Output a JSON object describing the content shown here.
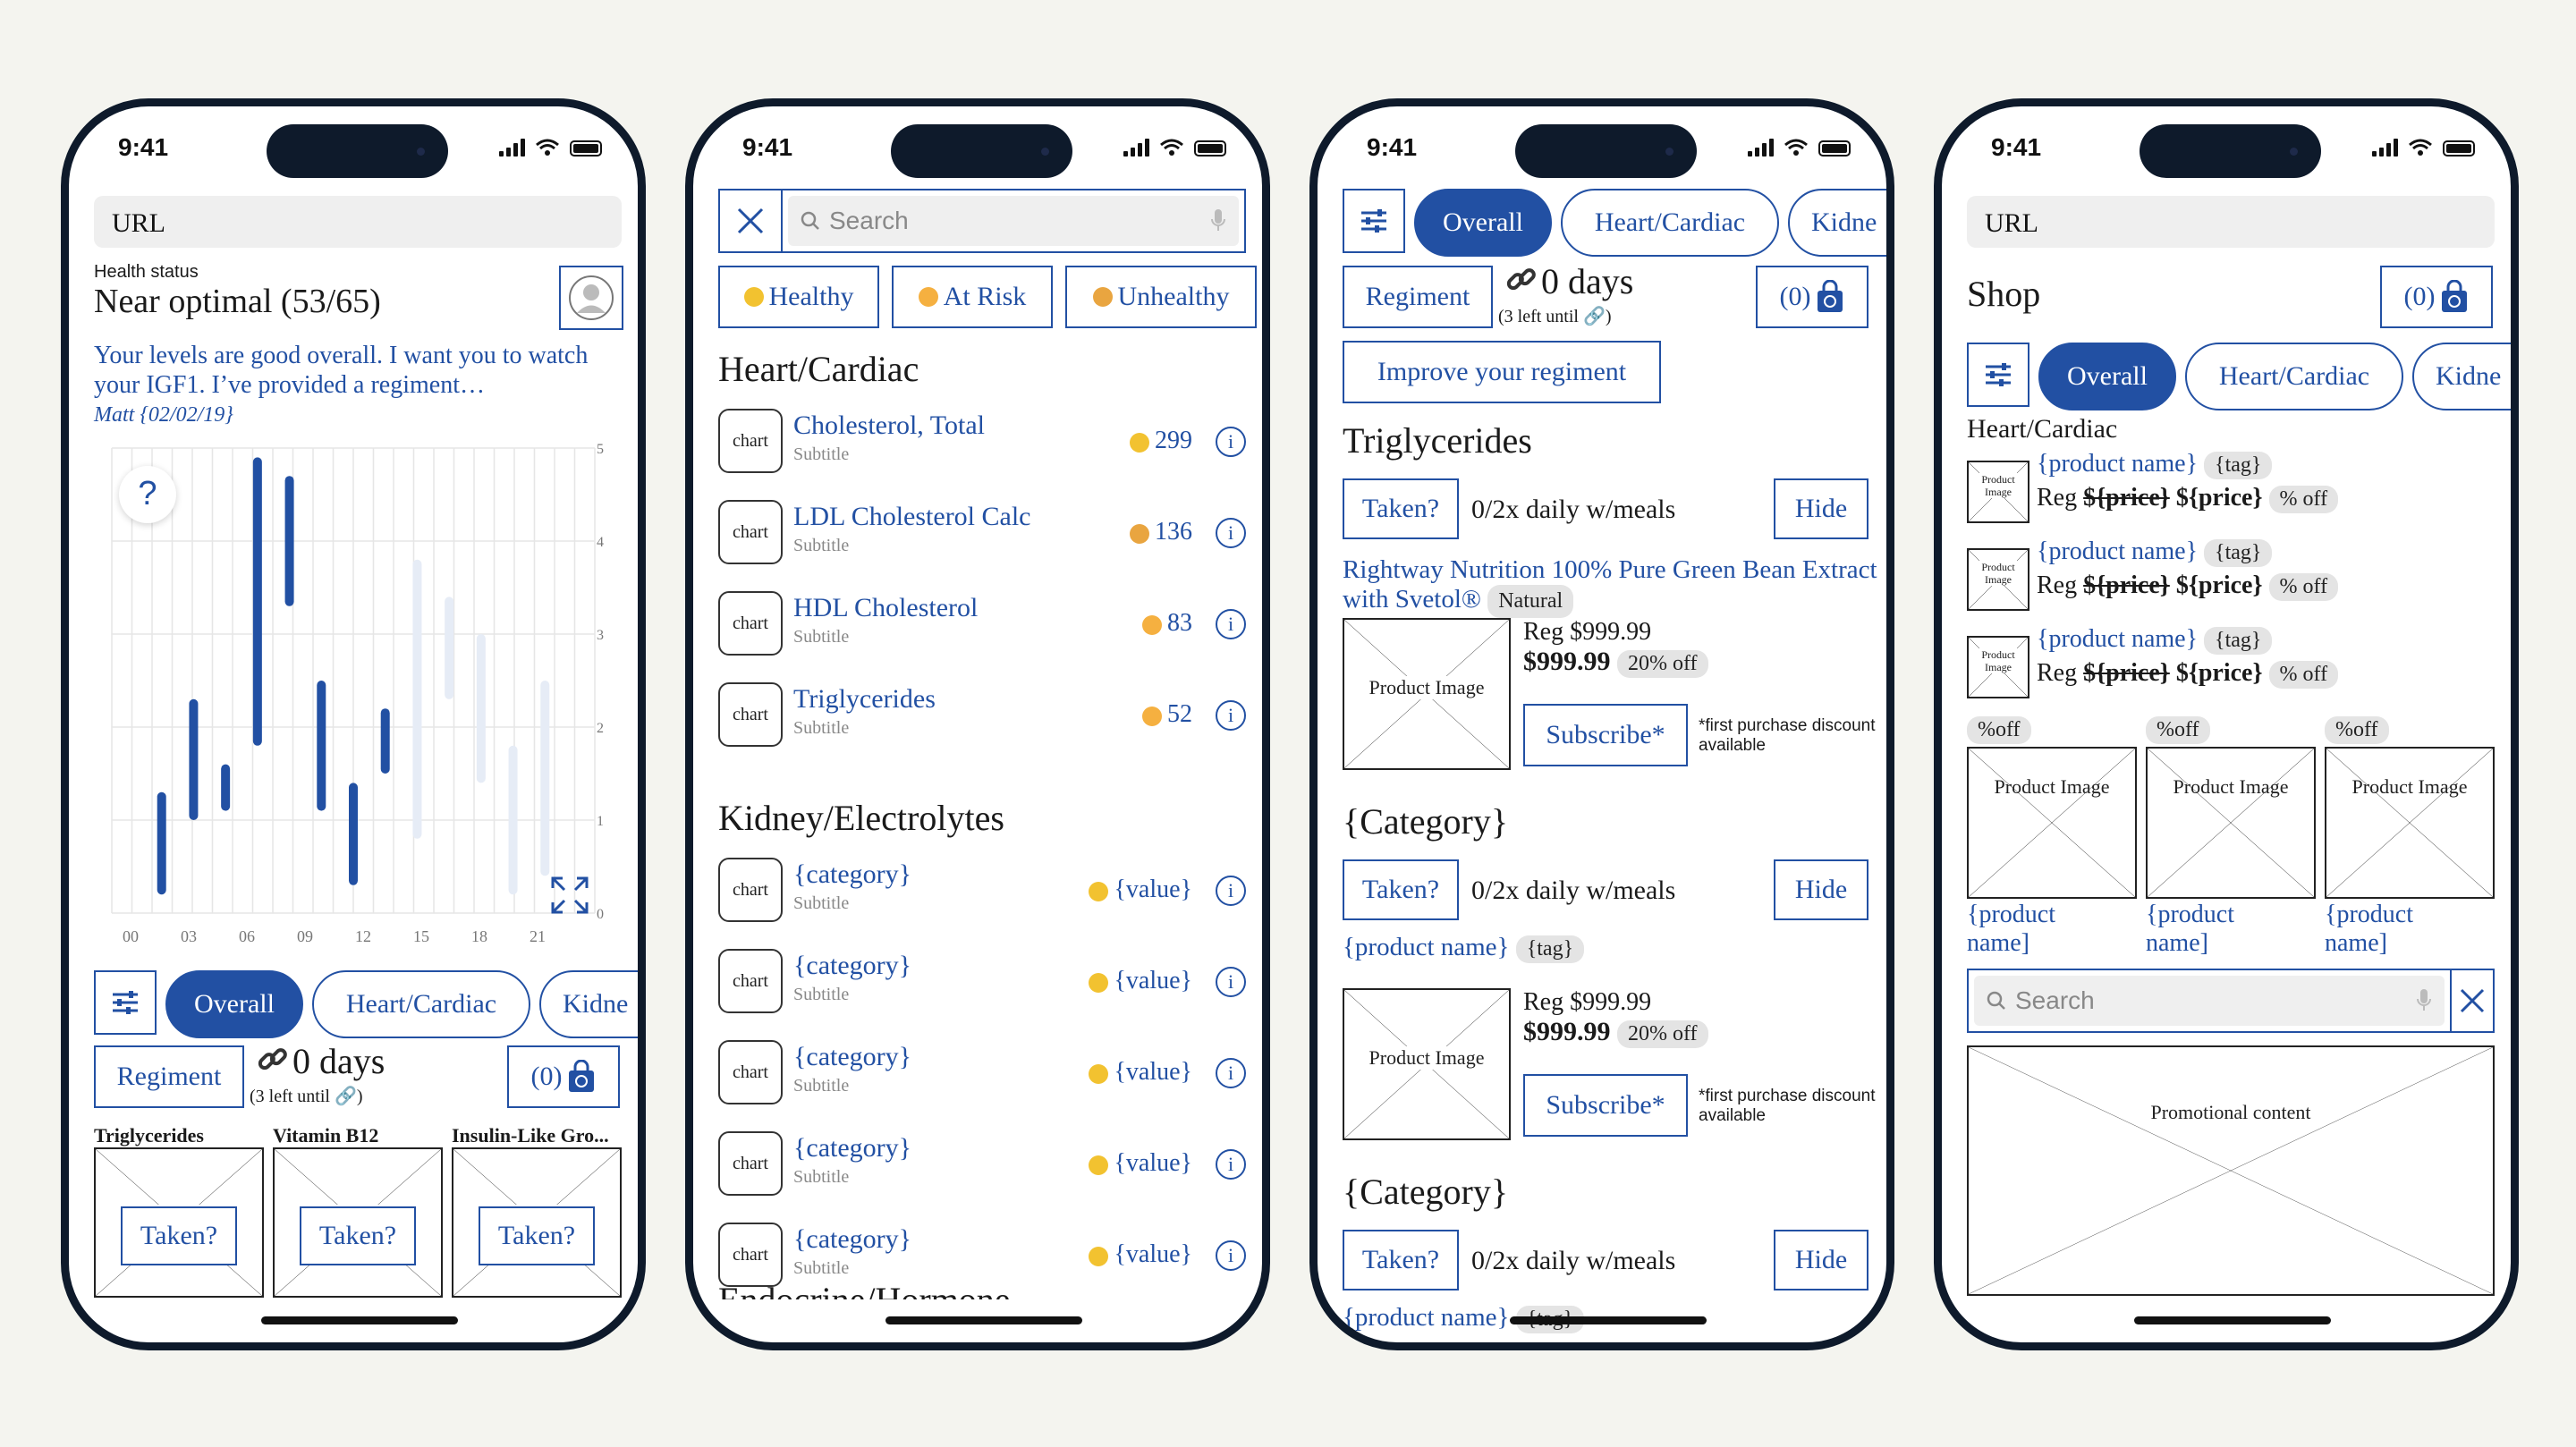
{
  "status": {
    "time": "9:41"
  },
  "p1": {
    "url": "URL",
    "health_label": "Health status",
    "health_value": "Near optimal (53/65)",
    "message": "Your levels are good overall. I want you to watch your IGF1. I’ve provided a regiment…",
    "signature": "Matt {02/02/19}",
    "y_ticks": [
      "5",
      "4",
      "3",
      "2",
      "1",
      "0"
    ],
    "x_ticks": [
      "00",
      "03",
      "06",
      "09",
      "12",
      "15",
      "18",
      "21"
    ],
    "help": "?",
    "tabs": [
      "Overall",
      "Heart/Cardiac",
      "Kidne"
    ],
    "regiment": "Regiment",
    "days": "0 days",
    "left_until": "(3 left until",
    "cart": "(0)",
    "cards": [
      {
        "title": "Triglycerides",
        "img": "Product Image",
        "btn": "Taken?"
      },
      {
        "title": "Vitamin B12",
        "img": "Product Image",
        "btn": "Taken?"
      },
      {
        "title": "Insulin-Like Gro...",
        "img": "Product Image",
        "btn": "Taken?"
      }
    ]
  },
  "chart_data": {
    "type": "bar",
    "xlabel": "",
    "ylabel": "",
    "x_ticks": [
      "00",
      "03",
      "06",
      "09",
      "12",
      "15",
      "18",
      "21"
    ],
    "ylim": [
      0,
      5
    ],
    "series": [
      {
        "values": [
          [
            1,
            0.2,
            1.3
          ],
          [
            2,
            1,
            2.3
          ],
          [
            3,
            1.1,
            1.6
          ],
          [
            4,
            1.8,
            4.9
          ],
          [
            5,
            3.3,
            4.7
          ],
          [
            6,
            1.1,
            2.5
          ],
          [
            7,
            0.3,
            1.4
          ],
          [
            8,
            1.5,
            2.2
          ]
        ]
      },
      {
        "values": [
          [
            9,
            0.8,
            3.8
          ],
          [
            10,
            2.3,
            3.4
          ],
          [
            11,
            1.4,
            3.0
          ],
          [
            12,
            0.2,
            1.8
          ],
          [
            13,
            0.4,
            2.5
          ]
        ]
      }
    ]
  },
  "p2": {
    "search": "Search",
    "filters": [
      "Healthy",
      "At Risk",
      "Unhealthy"
    ],
    "sections": [
      {
        "title": "Heart/Cardiac",
        "items": [
          {
            "name": "Cholesterol, Total",
            "sub": "Subtitle",
            "value": "299"
          },
          {
            "name": "LDL Cholesterol Calc",
            "sub": "Subtitle",
            "value": "136"
          },
          {
            "name": "HDL Cholesterol",
            "sub": "Subtitle",
            "value": "83"
          },
          {
            "name": "Triglycerides",
            "sub": "Subtitle",
            "value": "52"
          }
        ]
      },
      {
        "title": "Kidney/Electrolytes",
        "items": [
          {
            "name": "{category}",
            "sub": "Subtitle",
            "value": "{value}"
          },
          {
            "name": "{category}",
            "sub": "Subtitle",
            "value": "{value}"
          },
          {
            "name": "{category}",
            "sub": "Subtitle",
            "value": "{value}"
          },
          {
            "name": "{category}",
            "sub": "Subtitle",
            "value": "{value}"
          },
          {
            "name": "{category}",
            "sub": "Subtitle",
            "value": "{value}"
          }
        ]
      }
    ],
    "next_section": "Endocrine/Hormone",
    "chart_label": "chart",
    "info": "i"
  },
  "p3": {
    "tabs": [
      "Overall",
      "Heart/Cardiac",
      "Kidne"
    ],
    "regiment": "Regiment",
    "days": "0 days",
    "left_until": "(3 left until",
    "cart": "(0)",
    "improve": "Improve your regiment",
    "sections": [
      {
        "title": "Triglycerides",
        "taken": "Taken?",
        "dose": "0/2x daily w/meals",
        "hide": "Hide",
        "product": "Rightway Nutrition 100% Pure Green Bean Extract with Svetol®",
        "tag": "Natural",
        "img": "Product Image",
        "reg": "Reg $999.99",
        "price": "$999.99",
        "off": "20% off",
        "subscribe": "Subscribe*",
        "note": "*first purchase discount available"
      },
      {
        "title": "{Category}",
        "taken": "Taken?",
        "dose": "0/2x daily w/meals",
        "hide": "Hide",
        "product": "{product name}",
        "tag": "{tag}",
        "img": "Product Image",
        "reg": "Reg $999.99",
        "price": "$999.99",
        "off": "20% off",
        "subscribe": "Subscribe*",
        "note": "*first purchase discount available"
      },
      {
        "title": "{Category}",
        "taken": "Taken?",
        "dose": "0/2x daily w/meals",
        "hide": "Hide",
        "product": "{product name}",
        "tag": "{tag}"
      }
    ]
  },
  "p4": {
    "url": "URL",
    "title": "Shop",
    "cart": "(0)",
    "tabs": [
      "Overall",
      "Heart/Cardiac",
      "Kidne"
    ],
    "section": "Heart/Cardiac",
    "list": [
      {
        "img": "Product Image",
        "name": "{product name}",
        "tag": "{tag}",
        "reg": "Reg",
        "old": "${price}",
        "price": "${price}",
        "off": "% off"
      },
      {
        "img": "Product Image",
        "name": "{product name}",
        "tag": "{tag}",
        "reg": "Reg",
        "old": "${price}",
        "price": "${price}",
        "off": "% off"
      },
      {
        "img": "Product Image",
        "name": "{product name}",
        "tag": "{tag}",
        "reg": "Reg",
        "old": "${price}",
        "price": "${price}",
        "off": "% off"
      }
    ],
    "grid": [
      {
        "off": "%off",
        "img": "Product Image",
        "name": "{product name]"
      },
      {
        "off": "%off",
        "img": "Product Image",
        "name": "{product name]"
      },
      {
        "off": "%off",
        "img": "Product Image",
        "name": "{product name]"
      }
    ],
    "search": "Search",
    "promo": "Promotional content"
  },
  "colors": {
    "accent": "#2250a3",
    "frame": "#0e1a2b",
    "background": "#f4f4ef"
  }
}
